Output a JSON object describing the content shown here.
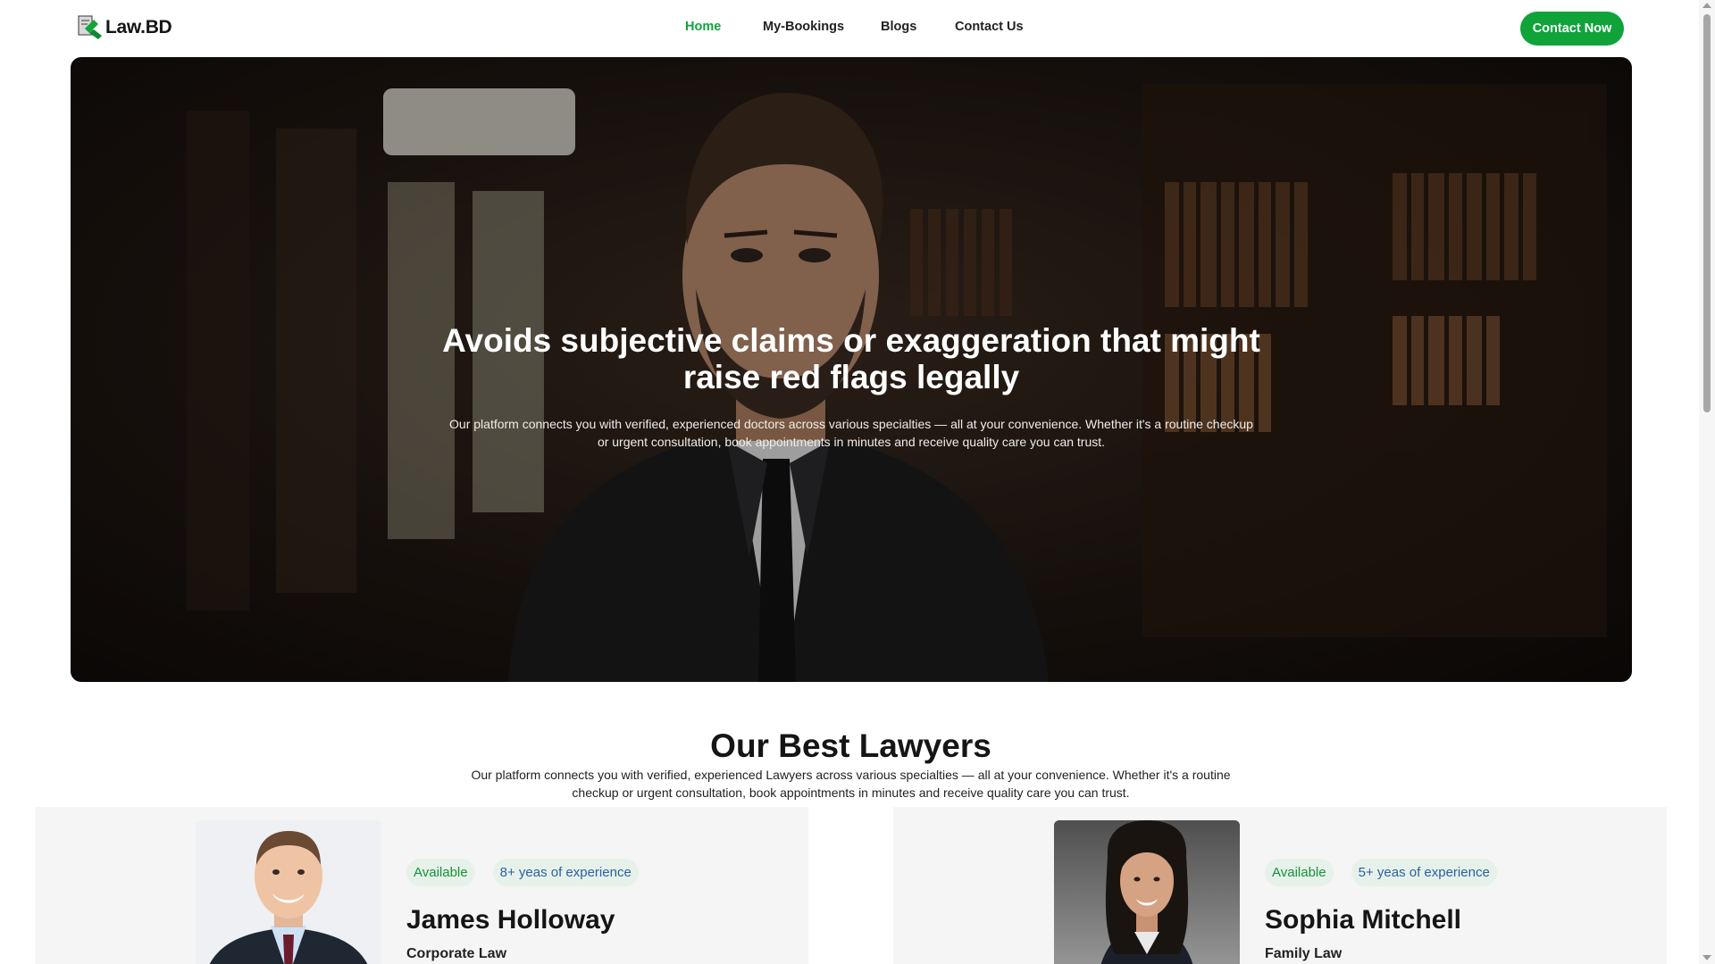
{
  "brand": {
    "name": "Law.BD"
  },
  "nav": {
    "links": [
      {
        "label": "Home",
        "active": true
      },
      {
        "label": "My-Bookings",
        "active": false
      },
      {
        "label": "Blogs",
        "active": false
      },
      {
        "label": "Contact Us",
        "active": false
      }
    ],
    "cta_label": "Contact Now"
  },
  "hero": {
    "title_line1": "Avoids subjective claims or exaggeration that might",
    "title_line2": "raise red flags legally",
    "subtitle": "Our platform connects you with verified, experienced doctors across various specialties — all at your convenience. Whether it's a routine checkup or urgent consultation, book appointments in minutes and receive quality care you can trust."
  },
  "section": {
    "title": "Our Best Lawyers",
    "subtitle": "Our platform connects you with verified, experienced Lawyers across various specialties — all at your convenience. Whether it's a routine checkup or urgent consultation, book appointments in minutes and receive quality care you can trust."
  },
  "lawyers": [
    {
      "status": "Available",
      "experience": "8+ yeas of experience",
      "name": "James Holloway",
      "specialty": "Corporate Law"
    },
    {
      "status": "Available",
      "experience": "5+ yeas of experience",
      "name": "Sophia Mitchell",
      "specialty": "Family Law"
    }
  ],
  "colors": {
    "accent": "#0fa33a",
    "badge_bg": "#e6f2e9",
    "badge_text": "#17913a",
    "experience_text": "#2c5fa5"
  }
}
